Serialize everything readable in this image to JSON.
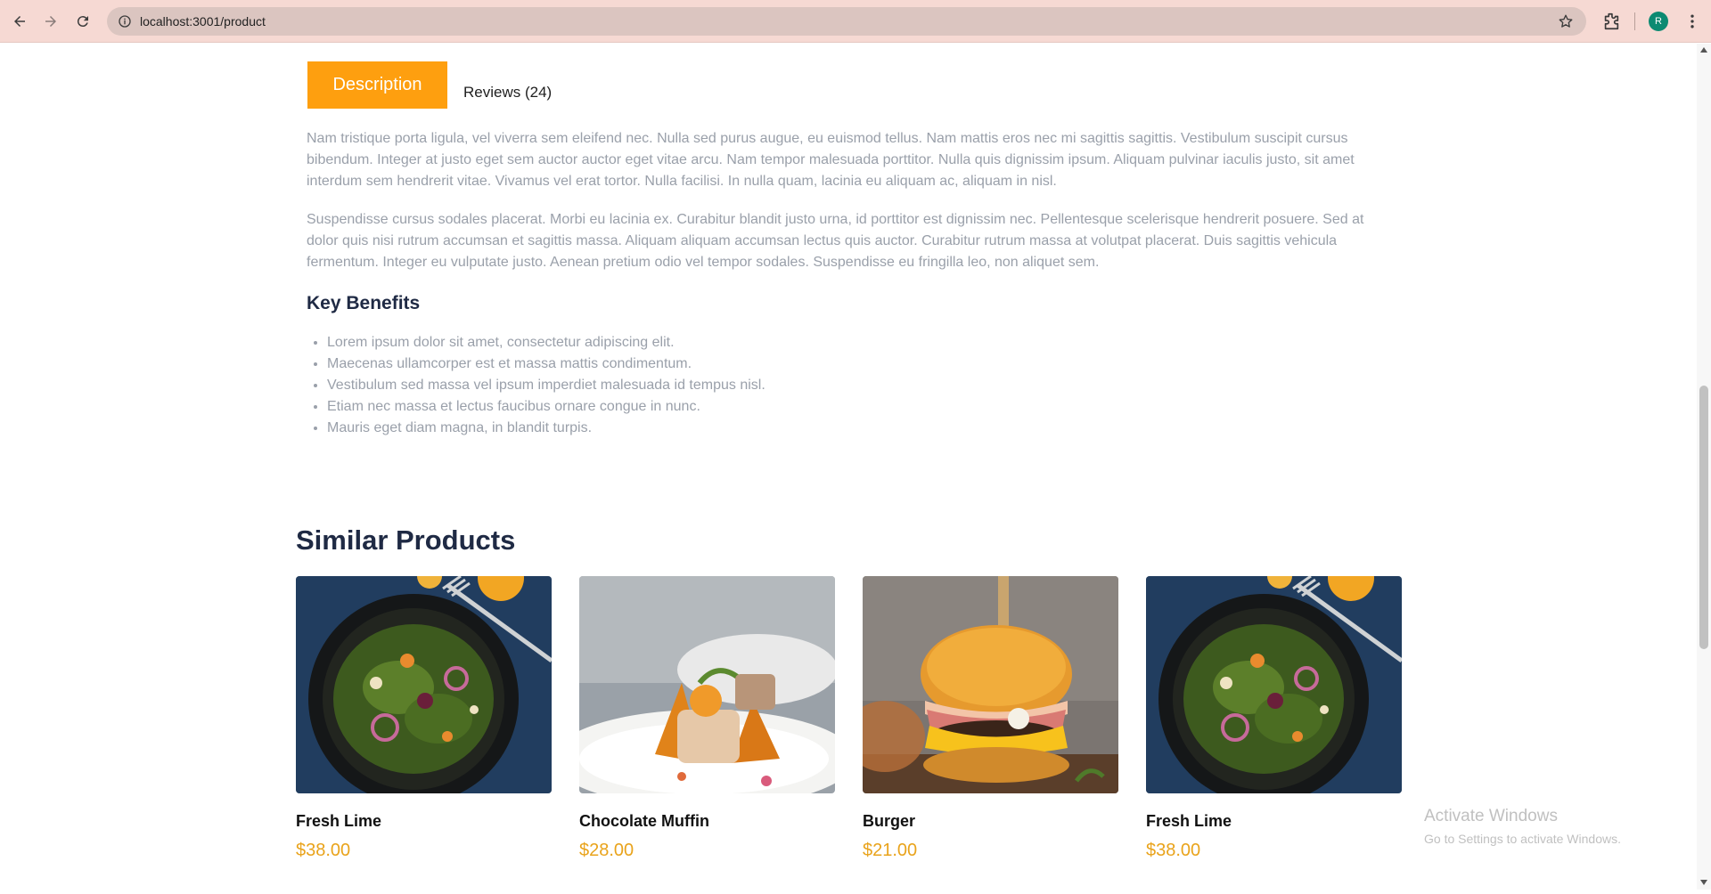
{
  "browser": {
    "url": "localhost:3001/product",
    "avatar_initial": "R"
  },
  "tabs": {
    "description": "Description",
    "reviews": "Reviews (24)"
  },
  "description": {
    "paragraph1": "Nam tristique porta ligula, vel viverra sem eleifend nec. Nulla sed purus augue, eu euismod tellus. Nam mattis eros nec mi sagittis sagittis. Vestibulum suscipit cursus bibendum. Integer at justo eget sem auctor auctor eget vitae arcu. Nam tempor malesuada porttitor. Nulla quis dignissim ipsum. Aliquam pulvinar iaculis justo, sit amet interdum sem hendrerit vitae. Vivamus vel erat tortor. Nulla facilisi. In nulla quam, lacinia eu aliquam ac, aliquam in nisl.",
    "paragraph2": "Suspendisse cursus sodales placerat. Morbi eu lacinia ex. Curabitur blandit justo urna, id porttitor est dignissim nec. Pellentesque scelerisque hendrerit posuere. Sed at dolor quis nisi rutrum accumsan et sagittis massa. Aliquam aliquam accumsan lectus quis auctor. Curabitur rutrum massa at volutpat placerat. Duis sagittis vehicula fermentum. Integer eu vulputate justo. Aenean pretium odio vel tempor sodales. Suspendisse eu fringilla leo, non aliquet sem."
  },
  "benefits": {
    "title": "Key Benefits",
    "items": [
      "Lorem ipsum dolor sit amet, consectetur adipiscing elit.",
      "Maecenas ullamcorper est et massa mattis condimentum.",
      "Vestibulum sed massa vel ipsum imperdiet malesuada id tempus nisl.",
      "Etiam nec massa et lectus faucibus ornare congue in nunc.",
      "Mauris eget diam magna, in blandit turpis."
    ]
  },
  "similar": {
    "title": "Similar Products",
    "products": [
      {
        "name": "Fresh Lime",
        "price": "$38.00",
        "image": "salad-bowl"
      },
      {
        "name": "Chocolate Muffin",
        "price": "$28.00",
        "image": "plated-dish"
      },
      {
        "name": "Burger",
        "price": "$21.00",
        "image": "burger"
      },
      {
        "name": "Fresh Lime",
        "price": "$38.00",
        "image": "salad-bowl"
      }
    ]
  },
  "watermark": {
    "line1": "Activate Windows",
    "line2": "Go to Settings to activate Windows."
  },
  "colors": {
    "accent": "#fe9f0f",
    "price": "#e9a31b",
    "heading": "#1f2a44",
    "body_text": "#9aa0aa"
  }
}
